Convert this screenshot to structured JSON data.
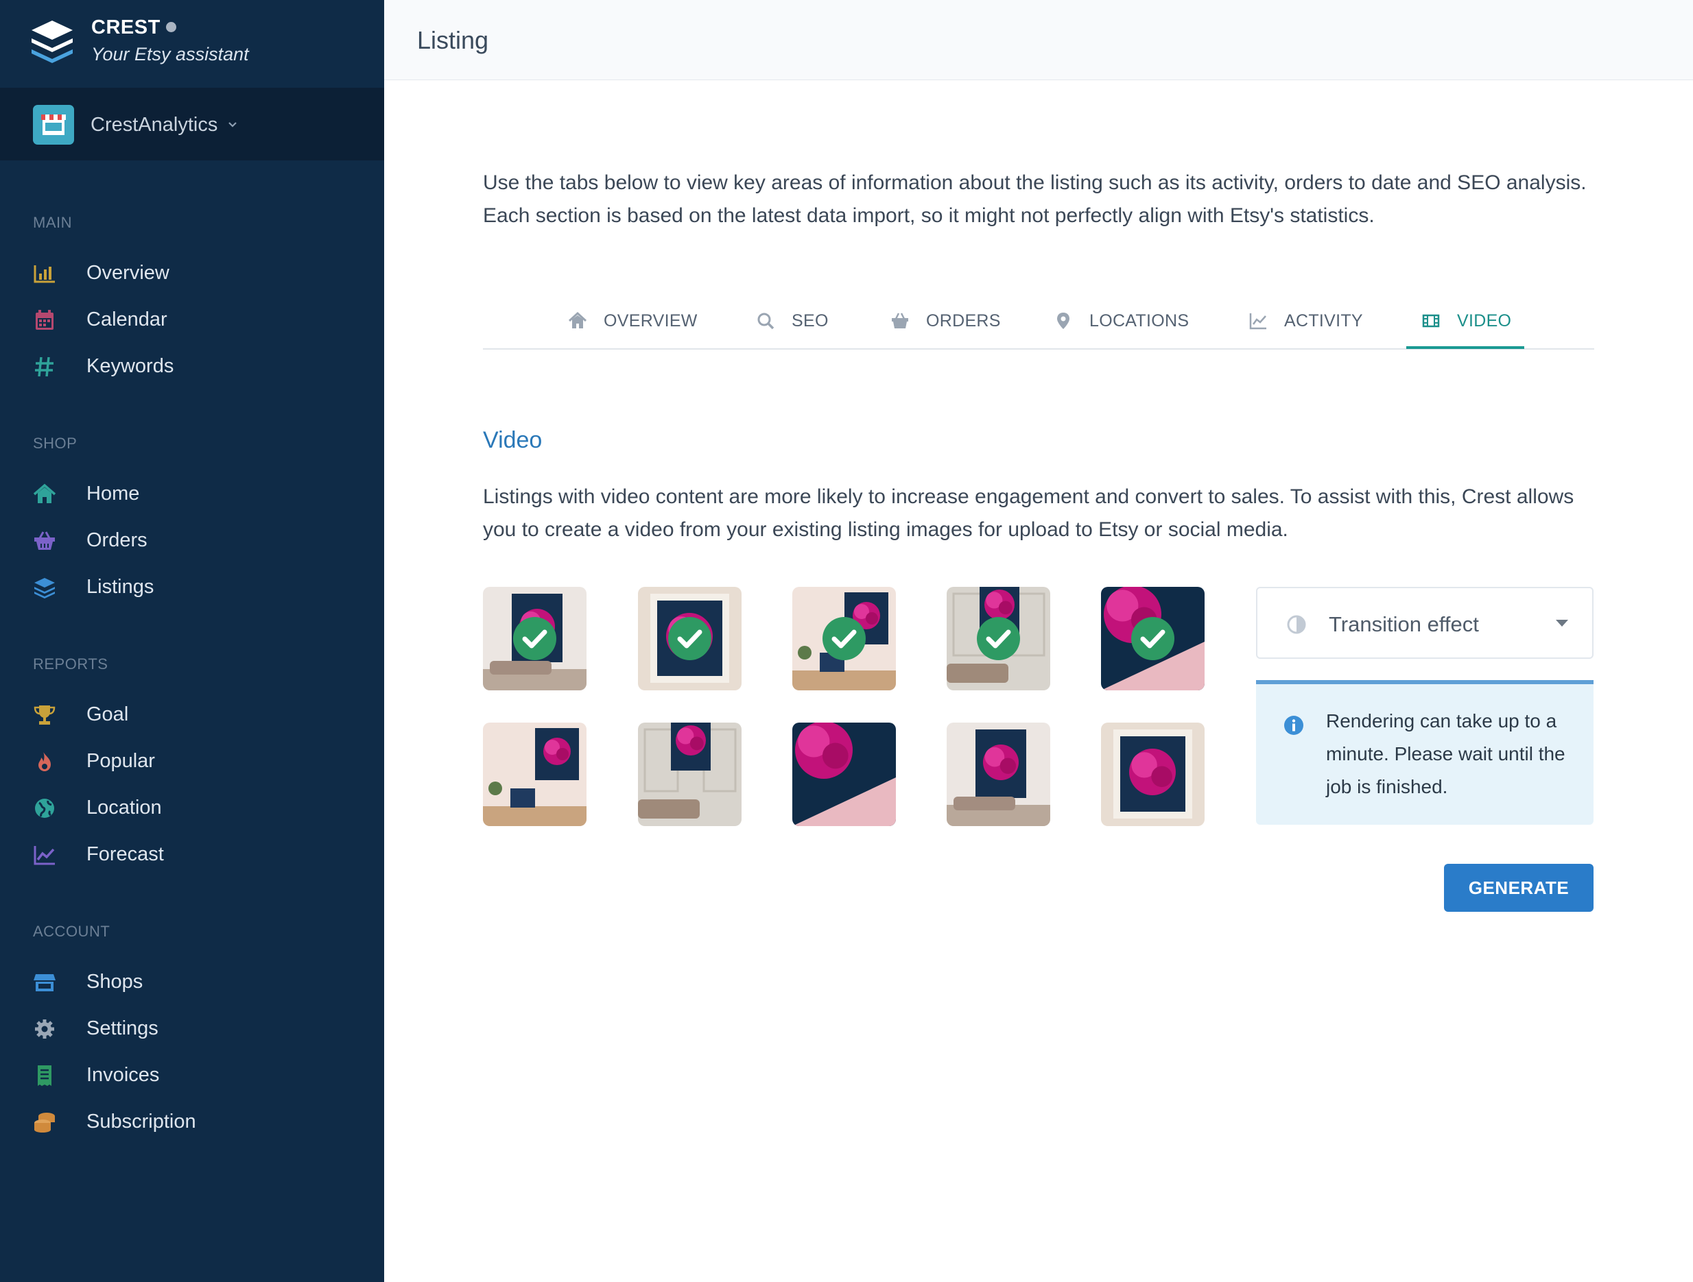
{
  "brand": {
    "name": "CREST",
    "tagline": "Your Etsy assistant",
    "logo_icon": "layers-logo-icon"
  },
  "shop_switcher": {
    "name": "CrestAnalytics",
    "icon": "storefront-icon",
    "caret_icon": "chevron-down-icon"
  },
  "sidebar": {
    "sections": [
      {
        "label": "MAIN",
        "items": [
          {
            "label": "Overview",
            "icon": "bar-chart-icon",
            "color": "#c9a23a"
          },
          {
            "label": "Calendar",
            "icon": "calendar-icon",
            "color": "#b5486f"
          },
          {
            "label": "Keywords",
            "icon": "hashtag-icon",
            "color": "#2fa39a"
          }
        ]
      },
      {
        "label": "SHOP",
        "items": [
          {
            "label": "Home",
            "icon": "home-icon",
            "color": "#2fa39a"
          },
          {
            "label": "Orders",
            "icon": "basket-icon",
            "color": "#7b62c9"
          },
          {
            "label": "Listings",
            "icon": "layers-icon",
            "color": "#3c8fd6"
          }
        ]
      },
      {
        "label": "REPORTS",
        "items": [
          {
            "label": "Goal",
            "icon": "trophy-icon",
            "color": "#c9a23a"
          },
          {
            "label": "Popular",
            "icon": "fire-icon",
            "color": "#d6665a"
          },
          {
            "label": "Location",
            "icon": "globe-icon",
            "color": "#2fa39a"
          },
          {
            "label": "Forecast",
            "icon": "line-chart-icon",
            "color": "#7b62c9"
          }
        ]
      },
      {
        "label": "ACCOUNT",
        "items": [
          {
            "label": "Shops",
            "icon": "store-icon",
            "color": "#3c8fd6"
          },
          {
            "label": "Settings",
            "icon": "gear-icon",
            "color": "#9aa7b6"
          },
          {
            "label": "Invoices",
            "icon": "receipt-icon",
            "color": "#2f9a63"
          },
          {
            "label": "Subscription",
            "icon": "coins-icon",
            "color": "#d08a3c"
          }
        ]
      }
    ]
  },
  "header": {
    "title": "Listing"
  },
  "main": {
    "intro": "Use the tabs below to view key areas of information about the listing such as its activity, orders to date and SEO analysis. Each section is based on the latest data import, so it might not perfectly align with Etsy's statistics.",
    "tabs": [
      {
        "label": "OVERVIEW",
        "icon": "home-icon"
      },
      {
        "label": "SEO",
        "icon": "search-icon"
      },
      {
        "label": "ORDERS",
        "icon": "basket-icon"
      },
      {
        "label": "LOCATIONS",
        "icon": "map-pin-icon"
      },
      {
        "label": "ACTIVITY",
        "icon": "line-chart-icon"
      },
      {
        "label": "VIDEO",
        "icon": "film-icon",
        "active": true
      }
    ],
    "video": {
      "heading": "Video",
      "description": "Listings with video content are more likely to increase engagement and convert to sales. To assist with this, Crest allows you to create a video from your existing listing images for upload to Etsy or social media.",
      "images": [
        {
          "scene": "room-sofa",
          "selected": true
        },
        {
          "scene": "framed-print",
          "selected": true
        },
        {
          "scene": "room-chair",
          "selected": true
        },
        {
          "scene": "panel-wall",
          "selected": true
        },
        {
          "scene": "closeup",
          "selected": true
        },
        {
          "scene": "room-chair",
          "selected": false
        },
        {
          "scene": "panel-wall",
          "selected": false
        },
        {
          "scene": "closeup",
          "selected": false
        },
        {
          "scene": "room-sofa",
          "selected": false
        },
        {
          "scene": "framed-print",
          "selected": false
        }
      ],
      "transition_select": {
        "label": "Transition effect",
        "icon": "half-circle-icon",
        "caret_icon": "caret-down-icon"
      },
      "info": {
        "text": "Rendering can take up to a minute. Please wait until the job is finished.",
        "icon": "info-icon"
      },
      "generate_label": "GENERATE"
    }
  },
  "colors": {
    "sidebar": "#0f2b47",
    "accent": "#1b9a93",
    "primary": "#2a7cc9",
    "heading": "#2a78b8",
    "check": "#2e9a63"
  }
}
